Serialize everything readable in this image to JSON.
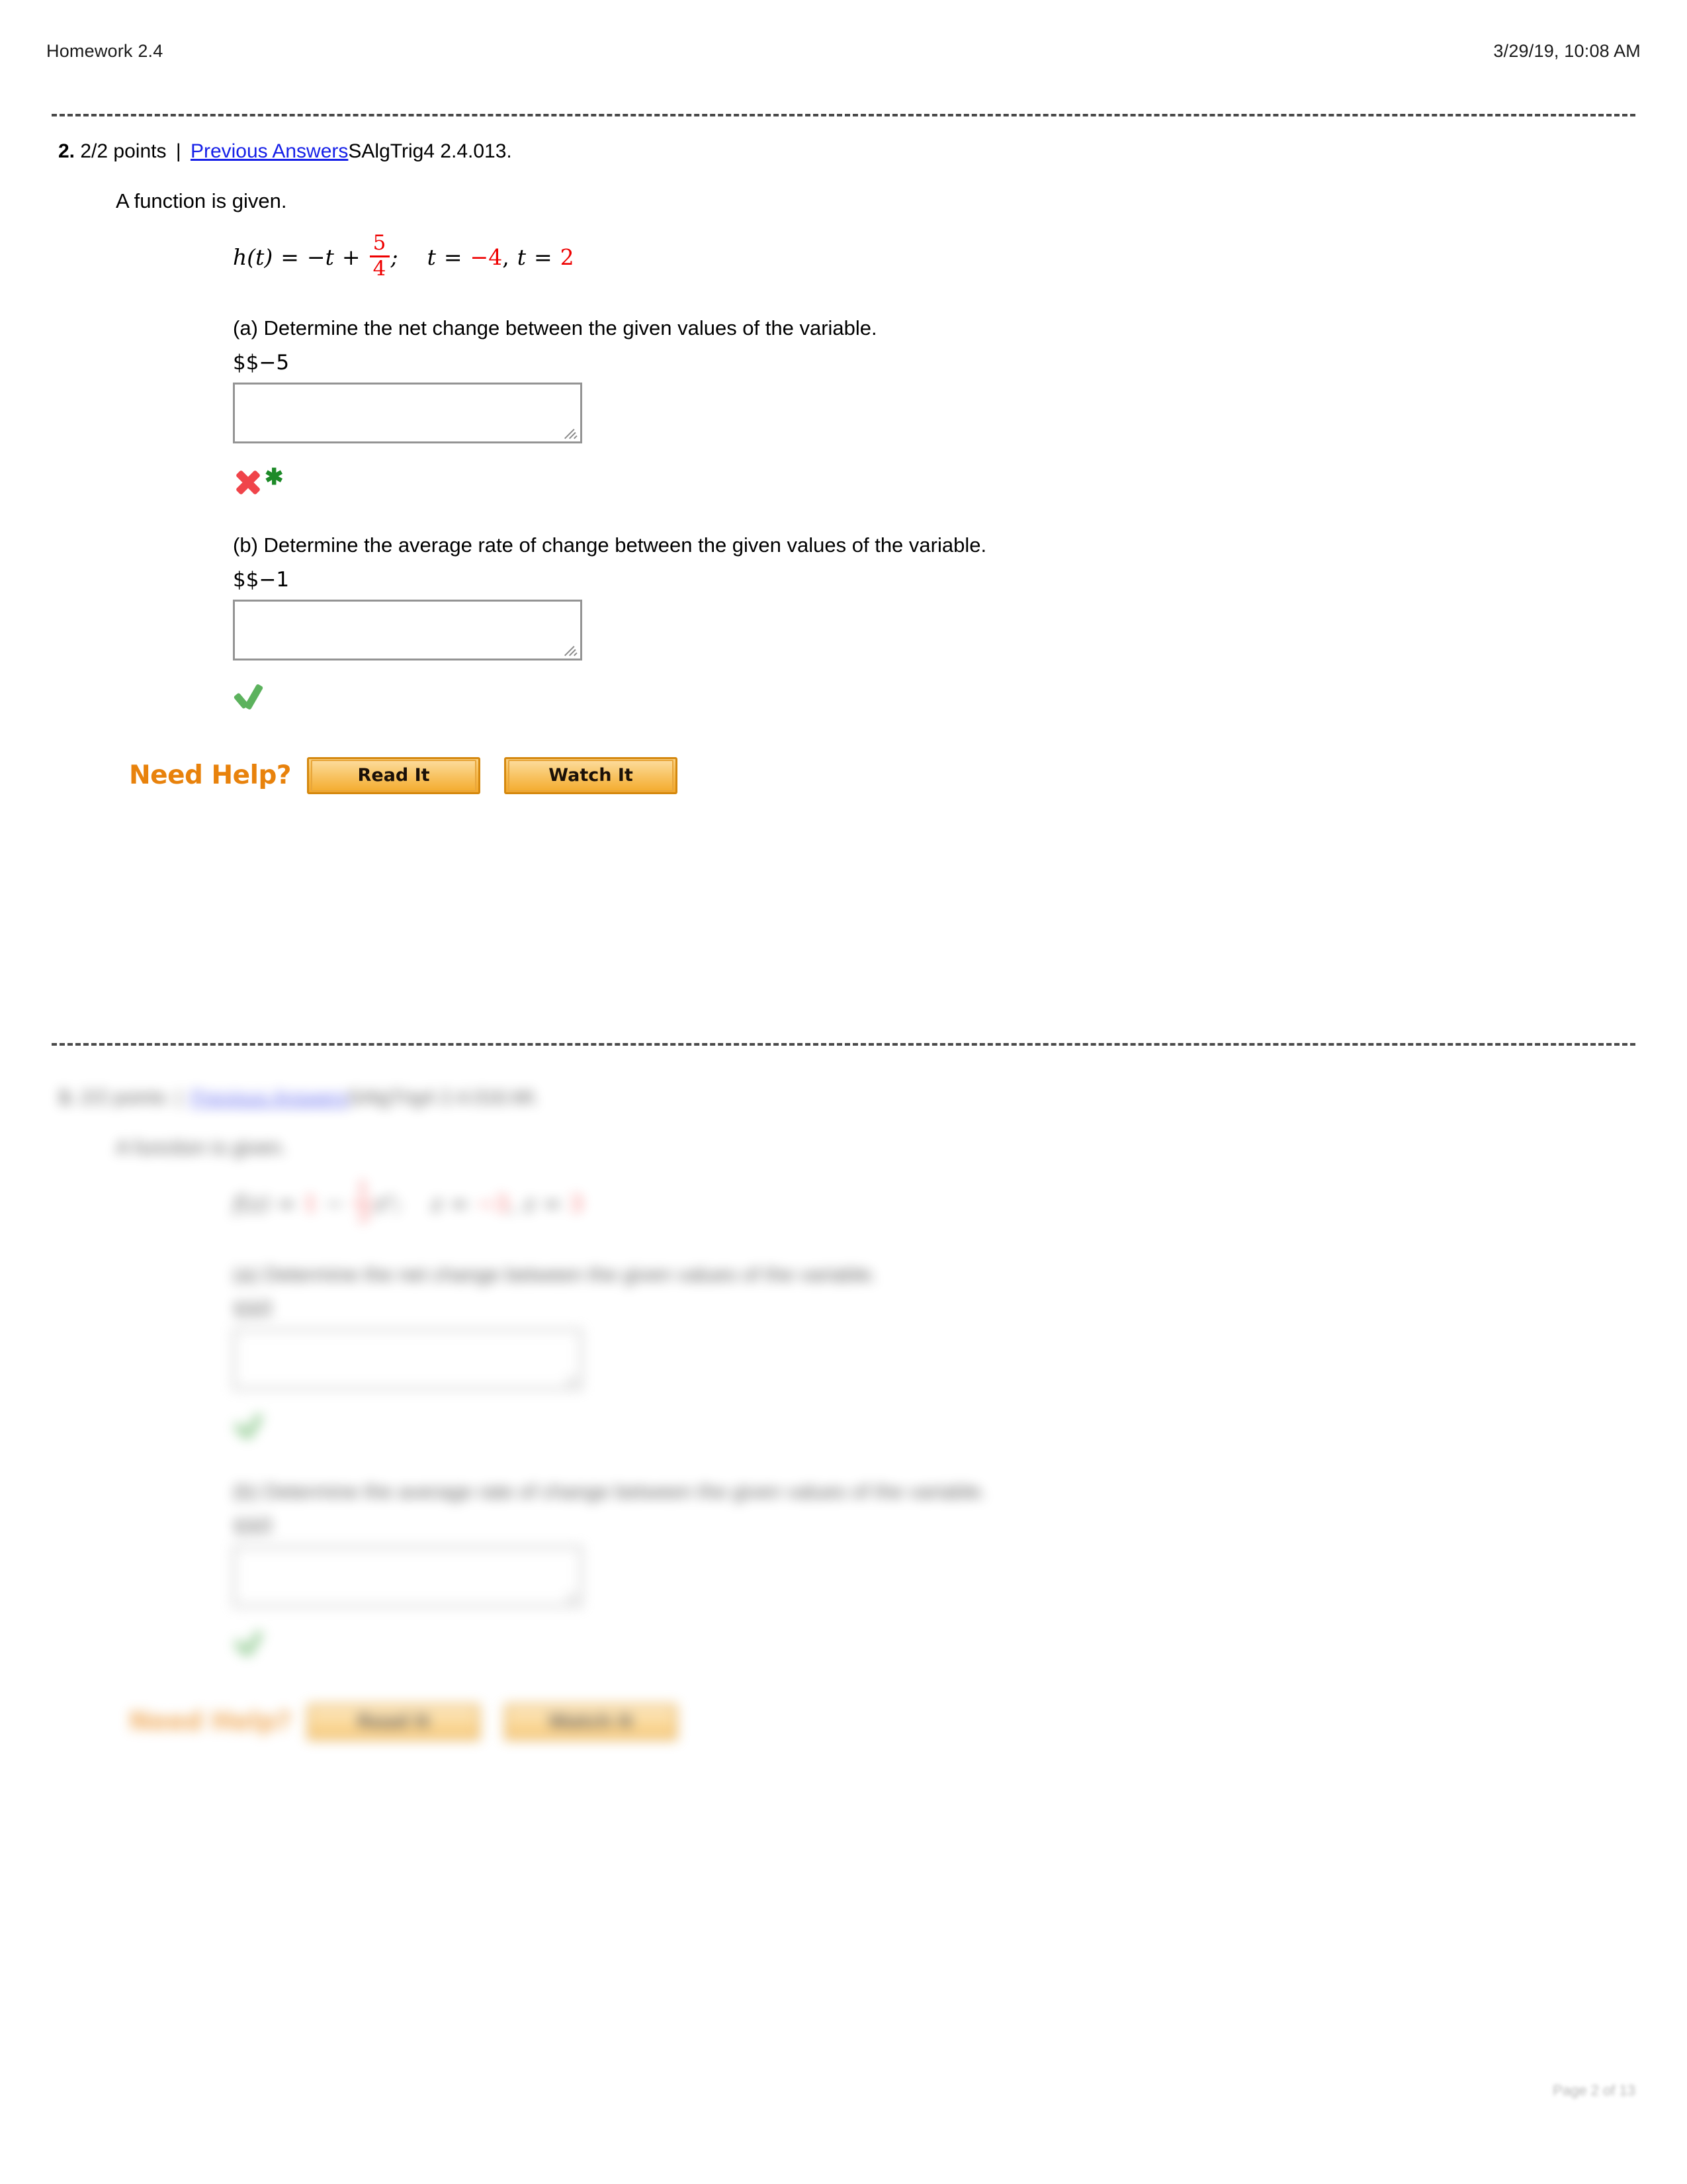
{
  "header": {
    "title": "Homework 2.4",
    "timestamp": "3/29/19, 10:08 AM"
  },
  "questions": [
    {
      "number": "2.",
      "points": "2/2 points",
      "separator": "|",
      "previous_answers_link": "Previous Answers",
      "code": "SAlgTrig4 2.4.013.",
      "prompt": "A function is given.",
      "formula": {
        "lhs": "h(t)",
        "equals": "=",
        "term": "−t",
        "plus": "+",
        "fraction_numerator": "5",
        "fraction_denominator": "4",
        "semicolon": ";",
        "var1_label": "t",
        "var1_eq": "=",
        "var1_value": "−4",
        "comma": ",",
        "var2_label": "t",
        "var2_eq": "=",
        "var2_value": "2",
        "accent_color": "#ee0000"
      },
      "parts": [
        {
          "label": "(a) Determine the net change between the given values of the variable.",
          "answer_echo": "$$−5",
          "input_value": "",
          "input_placeholder": "",
          "grade_icon": "red-x-icon",
          "grade_extra_icon": "green-asterisk-icon",
          "grade_extra_glyph": "✱"
        },
        {
          "label": "(b) Determine the average rate of change between the given values of the variable.",
          "answer_echo": "$$−1",
          "input_value": "",
          "input_placeholder": "",
          "grade_icon": "green-check-icon",
          "grade_extra_icon": "",
          "grade_extra_glyph": ""
        }
      ],
      "need_help": {
        "label": "Need Help?",
        "buttons": [
          {
            "label": "Read It",
            "name": "read-it-button"
          },
          {
            "label": "Watch It",
            "name": "watch-it-button"
          }
        ]
      }
    },
    {
      "number": "3.",
      "points": "2/2 points",
      "separator": "|",
      "previous_answers_link": "Previous Answers",
      "code": "SAlgTrig4 2.4.016.MI.",
      "prompt": "A function is given.",
      "formula": {
        "lhs": "f(z)",
        "equals": "=",
        "term": "1",
        "plus": "−",
        "fraction_numerator": "1",
        "fraction_denominator": "3",
        "semicolon": "z²;",
        "var1_label": "z",
        "var1_eq": "=",
        "var1_value": "−3",
        "comma": ",",
        "var2_label": "z",
        "var2_eq": "=",
        "var2_value": "3",
        "accent_color": "#ee0000"
      },
      "parts": [
        {
          "label": "(a) Determine the net change between the given values of the variable.",
          "answer_echo": "$$0",
          "input_value": "",
          "input_placeholder": "",
          "grade_icon": "green-check-icon",
          "grade_extra_icon": "",
          "grade_extra_glyph": ""
        },
        {
          "label": "(b) Determine the average rate of change between the given values of the variable.",
          "answer_echo": "$$0",
          "input_value": "",
          "input_placeholder": "",
          "grade_icon": "green-check-icon",
          "grade_extra_icon": "",
          "grade_extra_glyph": ""
        }
      ],
      "need_help": {
        "label": "Need Help?",
        "buttons": [
          {
            "label": "Read It",
            "name": "read-it-button"
          },
          {
            "label": "Watch It",
            "name": "watch-it-button"
          }
        ]
      }
    }
  ],
  "footer": {
    "left": "",
    "right": "Page 2 of 13"
  }
}
